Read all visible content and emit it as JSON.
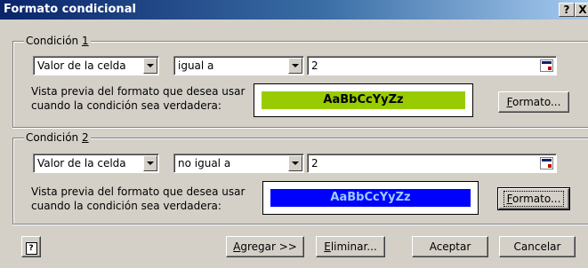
{
  "window": {
    "title": "Formato condicional",
    "help_btn": "?",
    "close_btn": "X"
  },
  "conditions": [
    {
      "label_prefix": "Condición ",
      "label_key": "1",
      "type_value": "Valor de la celda",
      "operator_value": "igual a",
      "input_value": "2",
      "description_line1": "Vista previa del formato que desea usar",
      "description_line2": "cuando la condición sea verdadera:",
      "preview_text": "AaBbCcYyZz",
      "preview_bg": "#99cc00",
      "preview_fg": "#000000",
      "format_label_key": "F",
      "format_label_rest": "ormato..."
    },
    {
      "label_prefix": "Condición ",
      "label_key": "2",
      "type_value": "Valor de la celda",
      "operator_value": "no igual a",
      "input_value": "2",
      "description_line1": "Vista previa del formato que desea usar",
      "description_line2": "cuando la condición sea verdadera:",
      "preview_text": "AaBbCcYyZz",
      "preview_bg": "#0000ff",
      "preview_fg": "#99ccff",
      "format_label_key": "F",
      "format_label_rest": "ormato..."
    }
  ],
  "footer": {
    "help_icon": "help-icon",
    "add_key": "A",
    "add_rest": "gregar >>",
    "delete_key": "E",
    "delete_rest": "liminar...",
    "accept": "Aceptar",
    "cancel": "Cancelar"
  }
}
